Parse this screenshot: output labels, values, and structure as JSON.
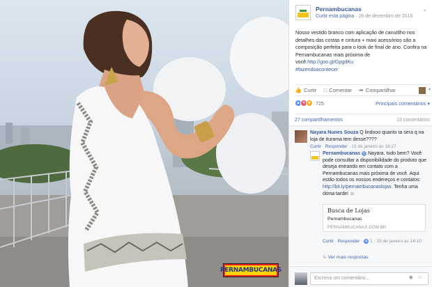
{
  "photo": {
    "brand_badge": "PERNAMBUCANAS"
  },
  "post": {
    "page_name": "Pernambucanas",
    "follow_label": "Curtir esta página",
    "separator": "·",
    "date": "26 de dezembro de 2016",
    "text_main": "Nosso vestido branco com aplicação de canutilho nos detalhes das costas e cintura + maxi acessórios são a composição perfeita para o look de final de ano. Confira na Pernambucanas mais próxima de você:",
    "text_link": "http://goo.gl/GpgdKu",
    "hashtag": "#fazendoacontecer"
  },
  "actions": {
    "like": "Curtir",
    "comment": "Comentar",
    "share": "Compartilhar"
  },
  "reactions": {
    "count": "725",
    "top_comments": "Principais comentários"
  },
  "counts": {
    "shares": "27 compartilhamentos",
    "comments": "13 comentários"
  },
  "comment1": {
    "author": "Nayara Nunes Souza",
    "text": "Q lindooo quanto ta sera q na loja de iturama tem desse????",
    "like_label": "Curtir",
    "reply_label": "Responder",
    "time": "13 de janeiro às 18:27"
  },
  "reply": {
    "author": "Pernambucanas",
    "text": "Nayara, tudo bem? Você pode consultar a disponibilidade do produto que deseja entrando em contato com a Pernambucanas mais próxima de você. Aqui estão todos os nossos endereços e contatos:",
    "link": "http://bit.ly/pernambucanaslojas",
    "text_after": ". Tenha uma ótima tarde!",
    "like_label": "Curtir",
    "reply_label": "Responder",
    "likes": "1",
    "time": "15 de janeiro às 14:10"
  },
  "link_card": {
    "title": "Busca de Lojas",
    "desc": "Pernambucanas",
    "url": "PERNAMBUCANAS.COM.BR"
  },
  "more_replies": "Ver mais respostas",
  "write": {
    "placeholder": "Escreva um comentário..."
  }
}
